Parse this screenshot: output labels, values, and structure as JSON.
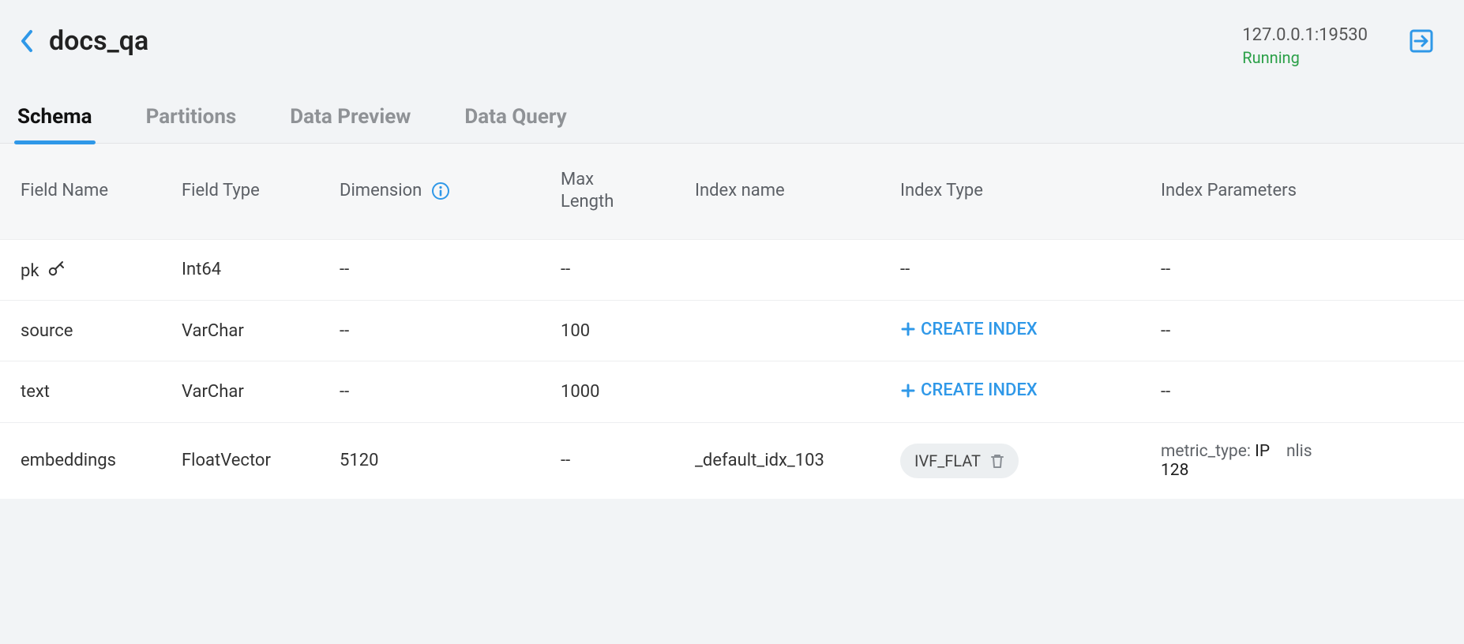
{
  "header": {
    "title": "docs_qa",
    "host": "127.0.0.1:19530",
    "status": "Running"
  },
  "tabs": [
    {
      "label": "Schema",
      "active": true
    },
    {
      "label": "Partitions",
      "active": false
    },
    {
      "label": "Data Preview",
      "active": false
    },
    {
      "label": "Data Query",
      "active": false
    }
  ],
  "columns": {
    "name": "Field Name",
    "type": "Field Type",
    "dimension": "Dimension",
    "max_length": "Max Length",
    "index_name": "Index name",
    "index_type": "Index Type",
    "index_params": "Index Parameters"
  },
  "create_index_label": "CREATE INDEX",
  "rows": [
    {
      "name": "pk",
      "is_primary": true,
      "type": "Int64",
      "dimension": "--",
      "max_length": "--",
      "index_name": "",
      "index_type_text": "--",
      "index_type_mode": "text",
      "params_text": "--"
    },
    {
      "name": "source",
      "is_primary": false,
      "type": "VarChar",
      "dimension": "--",
      "max_length": "100",
      "index_name": "",
      "index_type_mode": "create",
      "params_text": "--"
    },
    {
      "name": "text",
      "is_primary": false,
      "type": "VarChar",
      "dimension": "--",
      "max_length": "1000",
      "index_name": "",
      "index_type_mode": "create",
      "params_text": "--"
    },
    {
      "name": "embeddings",
      "is_primary": false,
      "type": "FloatVector",
      "dimension": "5120",
      "max_length": "--",
      "index_name": "_default_idx_103",
      "index_type_mode": "chip",
      "index_type_chip": "IVF_FLAT",
      "params": [
        {
          "key": "metric_type",
          "val": "IP"
        },
        {
          "key": "nlis",
          "val": "128"
        }
      ]
    }
  ]
}
